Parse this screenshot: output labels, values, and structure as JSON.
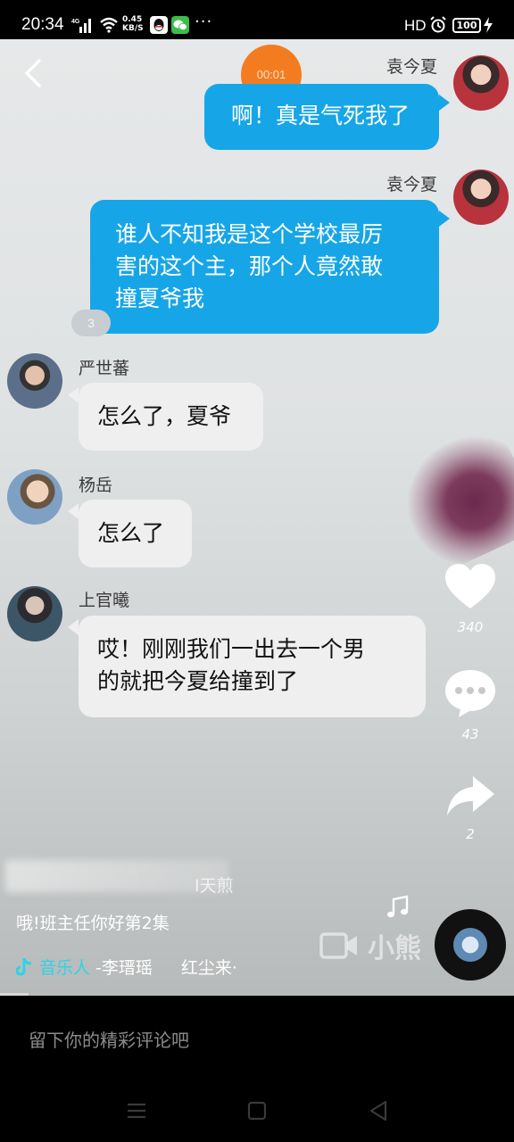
{
  "status_bar": {
    "time": "20:34",
    "network": "4G",
    "speed_value": "0.45",
    "speed_unit": "KB/S",
    "more": "···",
    "hd": "HD",
    "battery": "100"
  },
  "video": {
    "timer": "00:01",
    "chat": [
      {
        "sender": "袁今夏",
        "side": "right",
        "text": "啊！真是气死我了"
      },
      {
        "sender": "袁今夏",
        "side": "right",
        "text_lines": [
          "谁人不知我是这个学校最厉",
          "害的这个主，那个人竟然敢",
          "撞夏爷我"
        ],
        "badge": "3"
      },
      {
        "sender": "严世蕃",
        "side": "left",
        "text": "怎么了，夏爷"
      },
      {
        "sender": "杨岳",
        "side": "left",
        "text": "怎么了"
      },
      {
        "sender": "上官曦",
        "side": "left",
        "text_lines": [
          "哎！刚刚我们一出去一个男",
          "的就把今夏给撞到了"
        ]
      }
    ],
    "actions": {
      "like_count": "340",
      "comment_count": "43",
      "share_count": "2"
    },
    "author_suffix": "I天煎",
    "caption": "哦!班主任你好第2集",
    "music_tag": "音乐人",
    "music_artist": "-李瑨瑶",
    "song": "红尘来·",
    "watermark": "小熊"
  },
  "comment_placeholder": "留下你的精彩评论吧",
  "colors": {
    "bubble_blue": "#16a6e8",
    "bubble_gray": "#efefef",
    "timer_orange": "#f47c20",
    "music_cyan": "#2dd3e8"
  }
}
